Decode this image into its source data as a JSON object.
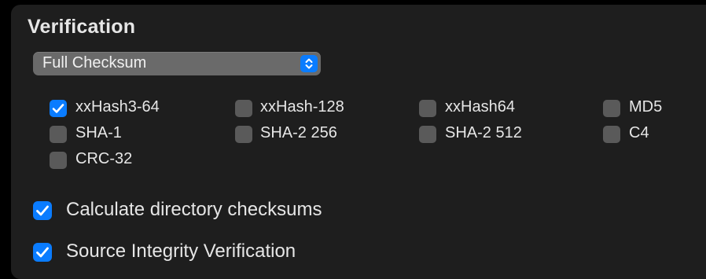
{
  "section": {
    "title": "Verification"
  },
  "mode_popup": {
    "selected": "Full Checksum"
  },
  "hash_options": [
    {
      "label": "xxHash3-64",
      "checked": true
    },
    {
      "label": "xxHash-128",
      "checked": false
    },
    {
      "label": "xxHash64",
      "checked": false
    },
    {
      "label": "MD5",
      "checked": false
    },
    {
      "label": "SHA-1",
      "checked": false
    },
    {
      "label": "SHA-2 256",
      "checked": false
    },
    {
      "label": "SHA-2 512",
      "checked": false
    },
    {
      "label": "C4",
      "checked": false
    },
    {
      "label": "CRC-32",
      "checked": false
    }
  ],
  "options": [
    {
      "label": "Calculate directory checksums",
      "checked": true
    },
    {
      "label": "Source Integrity Verification",
      "checked": true
    }
  ],
  "colors": {
    "accent": "#0a7cff",
    "panel": "#1e1e1e",
    "unchecked": "#5a5a5a"
  }
}
